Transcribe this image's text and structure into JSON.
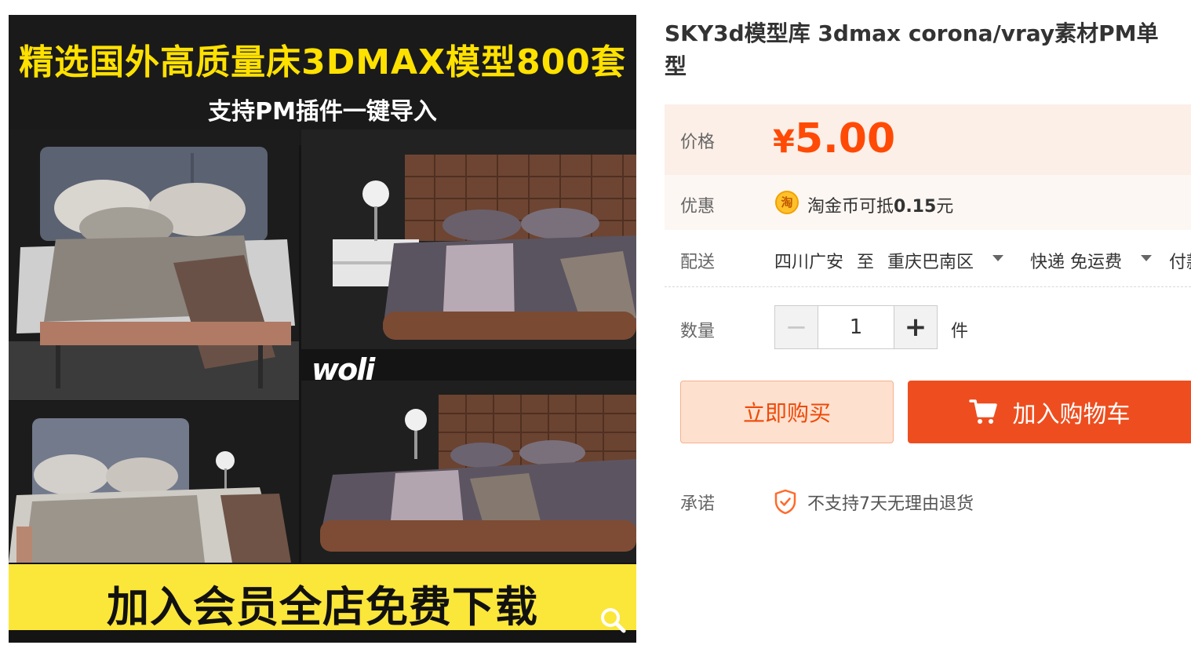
{
  "image": {
    "headline": "精选国外高质量床3DMAX模型800套",
    "subheadline": "支持PM插件一键导入",
    "logo_text": "woli",
    "footer_banner": "加入会员全店免费下载",
    "headline_color": "#ffe100",
    "footer_color": "#fbe63a",
    "zoom_icon": "search-icon"
  },
  "product": {
    "title_line1": "SKY3d模型库 3dmax corona/vray素材PM单",
    "title_line2": "型"
  },
  "price": {
    "label": "价格",
    "currency": "¥",
    "amount": "5.00",
    "color": "#ff4a06"
  },
  "promo": {
    "label": "优惠",
    "coin_glyph": "淘",
    "text_prefix": "淘金币可抵",
    "amount": "0.15",
    "text_suffix": "元"
  },
  "shipping": {
    "label": "配送",
    "origin": "四川广安",
    "to": "至",
    "destination": "重庆巴南区",
    "method": "快递 免运费",
    "extra": "付款后"
  },
  "quantity": {
    "label": "数量",
    "minus": "−",
    "value": "1",
    "plus": "+",
    "unit": "件"
  },
  "actions": {
    "buy_now": "立即购买",
    "add_to_cart": "加入购物车",
    "accent_color": "#ee4e1f"
  },
  "promise": {
    "label": "承诺",
    "text": "不支持7天无理由退货"
  }
}
